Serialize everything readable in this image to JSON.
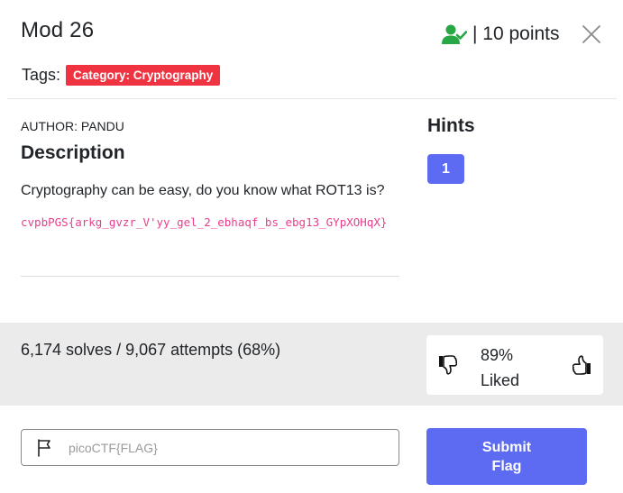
{
  "header": {
    "title": "Mod 26",
    "points_text": "| 10 points",
    "tags_label": "Tags:",
    "tag": "Category: Cryptography",
    "user_icon": "user-check-icon",
    "close_icon": "close-icon"
  },
  "challenge": {
    "author": "AUTHOR: PANDU",
    "description_heading": "Description",
    "description": "Cryptography can be easy, do you know what ROT13 is?",
    "flag_text": "cvpbPGS{arkg_gvzr_V'yy_gel_2_ebhaqf_bs_ebg13_GYpXOHqX}"
  },
  "hints": {
    "heading": "Hints",
    "items": [
      "1"
    ]
  },
  "stats": {
    "solves": "6,174 solves / 9,067 attempts (68%)",
    "liked_percent": "89%",
    "liked_label": "Liked"
  },
  "form": {
    "flag_placeholder": "picoCTF{FLAG}",
    "flag_value": "",
    "submit_label": "Submit Flag"
  },
  "colors": {
    "accent": "#5c6bf2",
    "tag": "#ef3340",
    "success": "#28a745",
    "code": "#e83e8c"
  }
}
